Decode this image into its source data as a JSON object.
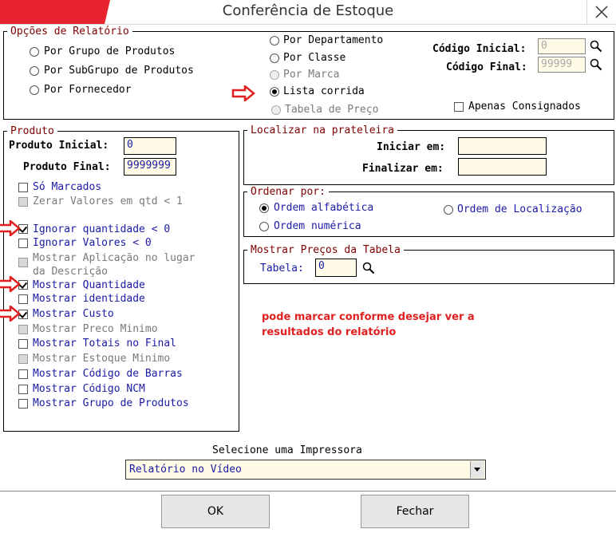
{
  "window": {
    "title": "Conferência de Estoque"
  },
  "report_options": {
    "legend": "Opções de Relatório",
    "group_by": [
      {
        "label": "Por Grupo de Produtos",
        "selected": false,
        "enabled": true
      },
      {
        "label": "Por SubGrupo de Produtos",
        "selected": false,
        "enabled": true
      },
      {
        "label": "Por Fornecedor",
        "selected": false,
        "enabled": true
      },
      {
        "label": "Por Departamento",
        "selected": false,
        "enabled": true
      },
      {
        "label": "Por Classe",
        "selected": false,
        "enabled": true
      },
      {
        "label": "Por Marca",
        "selected": false,
        "enabled": false
      },
      {
        "label": "Lista corrida",
        "selected": true,
        "enabled": true
      },
      {
        "label": "Tabela de Preço",
        "selected": false,
        "enabled": false
      }
    ],
    "codigo_inicial_label": "Código Inicial:",
    "codigo_inicial_value": "0",
    "codigo_final_label": "Código Final:",
    "codigo_final_value": "99999",
    "apenas_consignados_label": "Apenas Consignados",
    "apenas_consignados_checked": false
  },
  "produto": {
    "legend": "Produto",
    "produto_inicial_label": "Produto Inicial:",
    "produto_inicial_value": "0",
    "produto_final_label": "Produto Final:",
    "produto_final_value": "9999999",
    "checkboxes": [
      {
        "label": "Só Marcados",
        "checked": false,
        "enabled": true
      },
      {
        "label": "Zerar Valores em qtd < 1",
        "checked": false,
        "enabled": false
      },
      {
        "label": "Ignorar quantidade < 0",
        "checked": true,
        "enabled": true
      },
      {
        "label": "Ignorar Valores < 0",
        "checked": false,
        "enabled": true
      },
      {
        "label": "Mostrar Aplicação no lugar",
        "label2": "da Descrição",
        "checked": false,
        "enabled": false
      },
      {
        "label": "Mostrar Quantidade",
        "checked": true,
        "enabled": true
      },
      {
        "label": "Mostrar identidade",
        "checked": false,
        "enabled": true
      },
      {
        "label": "Mostrar Custo",
        "checked": true,
        "enabled": true
      },
      {
        "label": "Mostrar Preco Minimo",
        "checked": false,
        "enabled": false
      },
      {
        "label": "Mostrar Totais no Final",
        "checked": false,
        "enabled": true
      },
      {
        "label": "Mostrar Estoque Minimo",
        "checked": false,
        "enabled": false
      },
      {
        "label": "Mostrar Código de Barras",
        "checked": false,
        "enabled": true
      },
      {
        "label": "Mostrar Código NCM",
        "checked": false,
        "enabled": true
      },
      {
        "label": "Mostrar Grupo de Produtos",
        "checked": false,
        "enabled": true
      }
    ]
  },
  "localizar": {
    "legend": "Localizar na prateleira",
    "iniciar_label": "Iniciar em:",
    "iniciar_value": "",
    "finalizar_label": "Finalizar em:",
    "finalizar_value": ""
  },
  "ordenar": {
    "legend": "Ordenar por:",
    "options": [
      {
        "label": "Ordem alfabética",
        "selected": true
      },
      {
        "label": "Ordem numérica",
        "selected": false
      },
      {
        "label": "Ordem de Localização",
        "selected": false
      }
    ]
  },
  "precos": {
    "legend": "Mostrar Preços da Tabela",
    "tabela_label": "Tabela:",
    "tabela_value": "0"
  },
  "annotation": {
    "line1": "pode marcar conforme desejar ver a",
    "line2": "resultados do relatório",
    "color": "#e02020"
  },
  "impressora": {
    "label": "Selecione uma Impressora",
    "selected": "Relatório no Vídeo"
  },
  "buttons": {
    "ok": "OK",
    "fechar": "Fechar"
  }
}
